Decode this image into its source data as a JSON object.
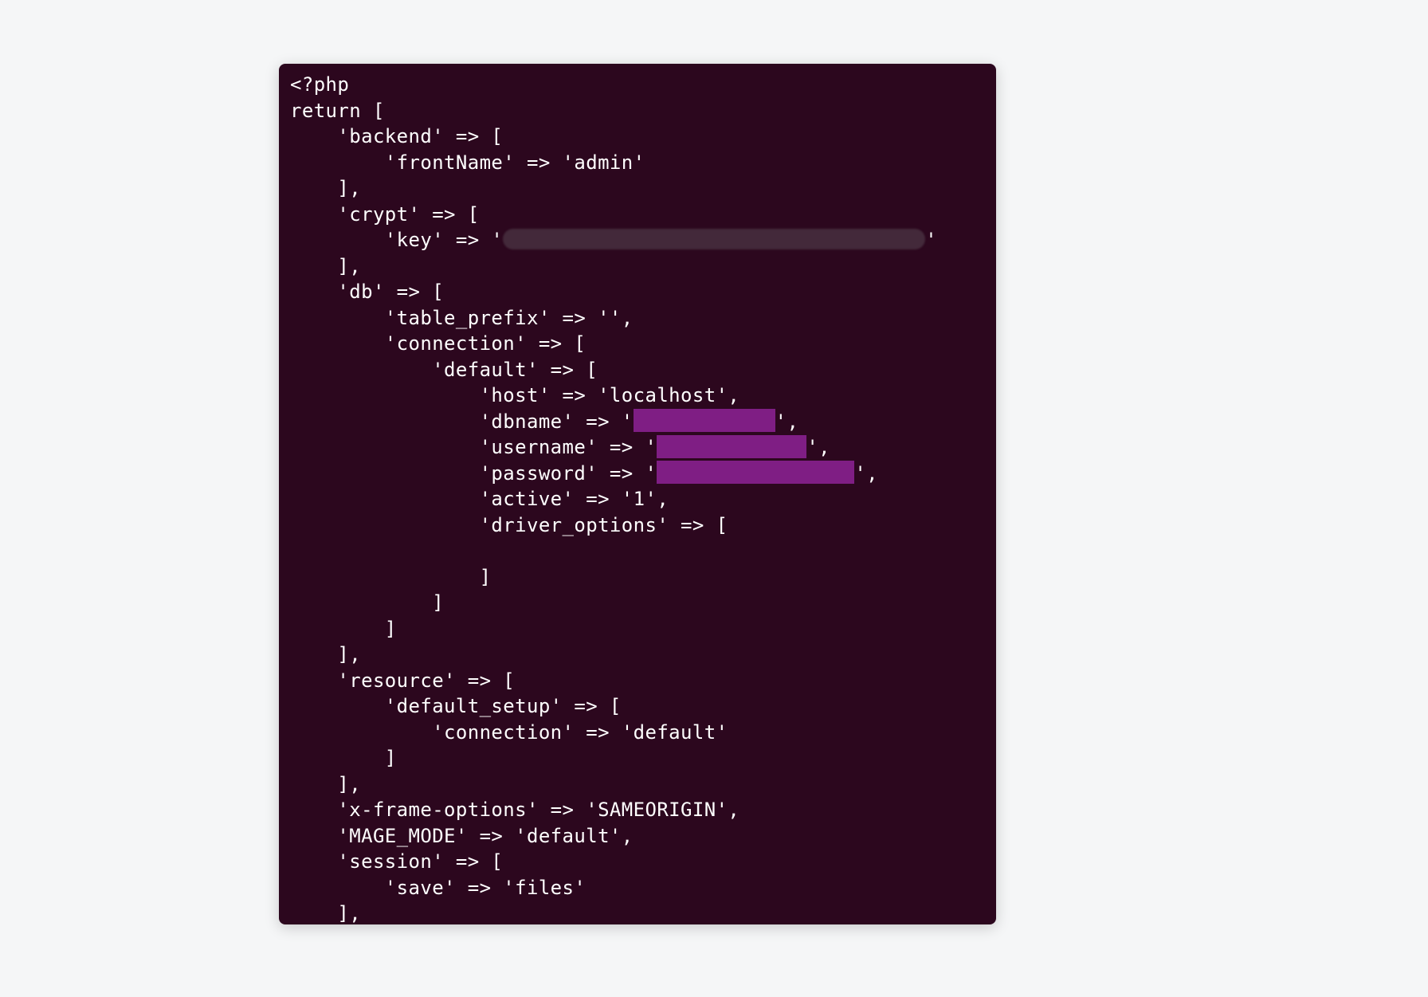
{
  "code": {
    "l1": "<?php",
    "l2": "return [",
    "l3": "    'backend' => [",
    "l4": "        'frontName' => 'admin'",
    "l5": "    ],",
    "l6": "    'crypt' => [",
    "l7a": "        'key' => '",
    "l7b": "'",
    "l8": "    ],",
    "l9": "    'db' => [",
    "l10": "        'table_prefix' => '',",
    "l11": "        'connection' => [",
    "l12": "            'default' => [",
    "l13": "                'host' => 'localhost',",
    "l14a": "                'dbname' => '",
    "l14b": "',",
    "l15a": "                'username' => '",
    "l15b": "',",
    "l16a": "                'password' => '",
    "l16b": "',",
    "l17": "                'active' => '1',",
    "l18": "                'driver_options' => [",
    "l19": "",
    "l20": "                ]",
    "l21": "            ]",
    "l22": "        ]",
    "l23": "    ],",
    "l24": "    'resource' => [",
    "l25": "        'default_setup' => [",
    "l26": "            'connection' => 'default'",
    "l27": "        ]",
    "l28": "    ],",
    "l29": "    'x-frame-options' => 'SAMEORIGIN',",
    "l30": "    'MAGE_MODE' => 'default',",
    "l31": "    'session' => [",
    "l32": "        'save' => 'files'",
    "l33": "    ],"
  }
}
